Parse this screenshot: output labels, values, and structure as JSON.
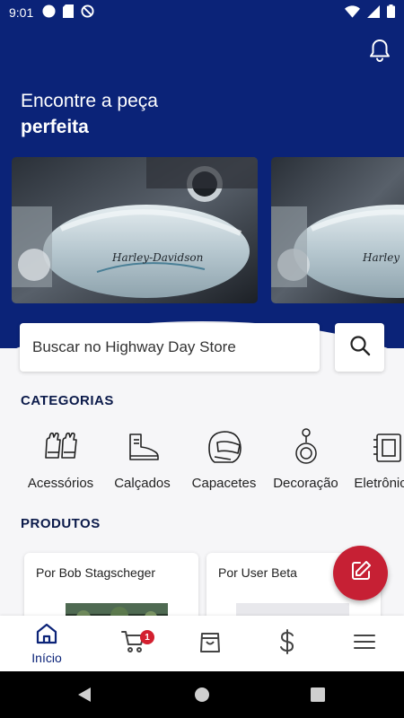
{
  "status_bar": {
    "time": "9:01",
    "icons": [
      "circle-icon",
      "sd-card-icon",
      "do-not-disturb-icon"
    ],
    "right_icons": [
      "wifi-icon",
      "signal-icon",
      "battery-icon"
    ]
  },
  "header": {
    "headline_line1": "Encontre a peça",
    "headline_line2": "perfeita",
    "bell_icon": "bell-icon"
  },
  "banners": [
    {
      "name": "motorcycle-tank-banner-1"
    },
    {
      "name": "motorcycle-tank-banner-2"
    }
  ],
  "search": {
    "placeholder": "Buscar no Highway Day Store",
    "button_icon": "search-icon"
  },
  "categories": {
    "title": "CATEGORIAS",
    "items": [
      {
        "label": "Acessórios",
        "icon": "gloves-icon"
      },
      {
        "label": "Calçados",
        "icon": "boot-icon"
      },
      {
        "label": "Capacetes",
        "icon": "helmet-icon"
      },
      {
        "label": "Decoração",
        "icon": "keychain-icon"
      },
      {
        "label": "Eletrônicos",
        "icon": "electronics-icon"
      }
    ]
  },
  "products": {
    "title": "PRODUTOS",
    "items": [
      {
        "seller": "Por Bob Stagscheger"
      },
      {
        "seller": "Por User Beta"
      }
    ]
  },
  "fab": {
    "icon": "edit-icon"
  },
  "bottom_nav": {
    "items": [
      {
        "label": "Início",
        "icon": "home-icon",
        "active": true
      },
      {
        "label": "",
        "icon": "cart-icon",
        "badge": "1"
      },
      {
        "label": "",
        "icon": "bag-icon"
      },
      {
        "label": "",
        "icon": "dollar-icon"
      },
      {
        "label": "",
        "icon": "menu-icon"
      }
    ]
  },
  "colors": {
    "brand_blue": "#0b2378",
    "fab_red": "#c62034",
    "background": "#f6f6f8"
  }
}
